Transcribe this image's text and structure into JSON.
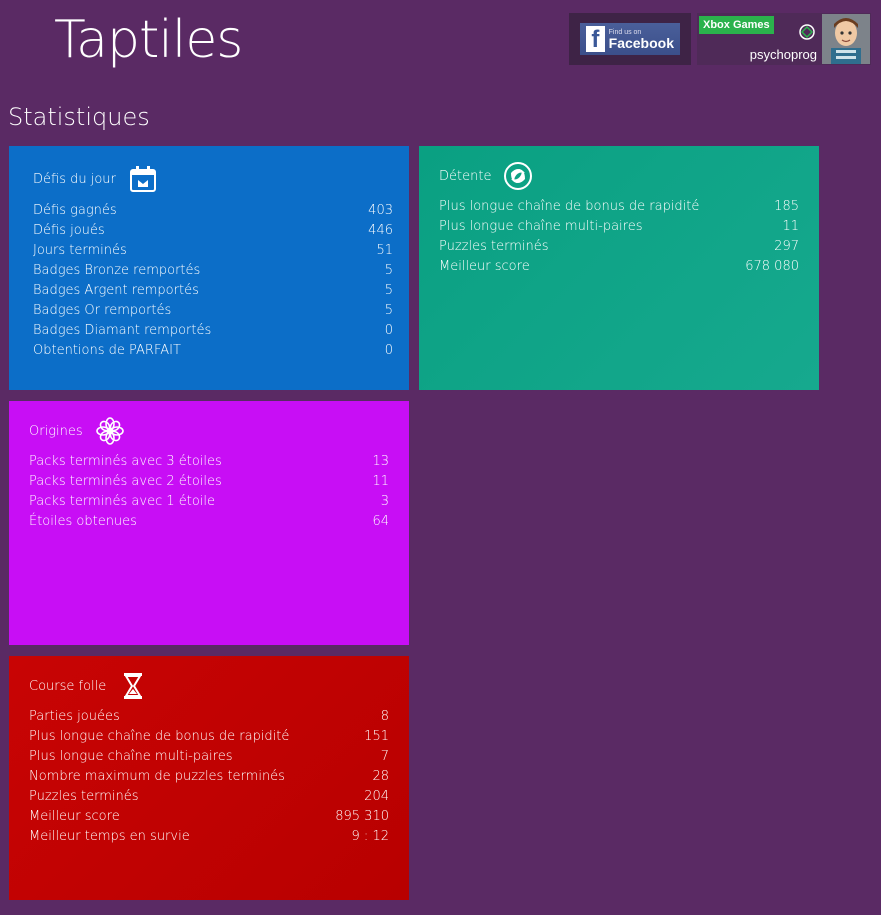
{
  "app": {
    "title": "Taptiles"
  },
  "page": {
    "title": "Statistiques"
  },
  "facebook": {
    "small": "Find us on",
    "big": "Facebook"
  },
  "xbox": {
    "badge": "Xbox Games",
    "username": "psychoprog"
  },
  "colors": {
    "background": "#5a2a64",
    "tile_defis": "#0c6ec8",
    "tile_detente": "#0aa082",
    "tile_origines": "#c80ef5",
    "tile_course": "#c80404",
    "xbox_green": "#2bb24c"
  },
  "tiles": {
    "defis": {
      "title": "Défis du jour",
      "icon": "calendar-icon",
      "rows": [
        {
          "label": "Défis gagnés",
          "value": "403"
        },
        {
          "label": "Défis joués",
          "value": "446"
        },
        {
          "label": "Jours terminés",
          "value": "51"
        },
        {
          "label": "Badges Bronze remportés",
          "value": "5"
        },
        {
          "label": "Badges Argent remportés",
          "value": "5"
        },
        {
          "label": "Badges Or remportés",
          "value": "5"
        },
        {
          "label": "Badges Diamant remportés",
          "value": "0"
        },
        {
          "label": "Obtentions de PARFAIT",
          "value": "0"
        }
      ]
    },
    "detente": {
      "title": "Détente",
      "icon": "swirl-icon",
      "rows": [
        {
          "label": "Plus longue chaîne de bonus de rapidité",
          "value": "185"
        },
        {
          "label": "Plus longue chaîne multi-paires",
          "value": "11"
        },
        {
          "label": "Puzzles terminés",
          "value": "297"
        },
        {
          "label": "Meilleur score",
          "value": "678 080"
        }
      ]
    },
    "origines": {
      "title": "Origines",
      "icon": "flower-icon",
      "rows": [
        {
          "label": "Packs terminés avec 3 étoiles",
          "value": "13"
        },
        {
          "label": "Packs terminés avec 2 étoiles",
          "value": "11"
        },
        {
          "label": "Packs terminés avec 1 étoile",
          "value": "3"
        },
        {
          "label": "Étoiles obtenues",
          "value": "64"
        }
      ]
    },
    "course": {
      "title": "Course folle",
      "icon": "hourglass-icon",
      "rows": [
        {
          "label": "Parties jouées",
          "value": "8"
        },
        {
          "label": "Plus longue chaîne de bonus de rapidité",
          "value": "151"
        },
        {
          "label": "Plus longue chaîne multi-paires",
          "value": "7"
        },
        {
          "label": "Nombre maximum de puzzles terminés",
          "value": "28"
        },
        {
          "label": "Puzzles terminés",
          "value": "204"
        },
        {
          "label": "Meilleur score",
          "value": "895 310"
        },
        {
          "label": "Meilleur temps en survie",
          "value": "9 : 12"
        }
      ]
    }
  }
}
